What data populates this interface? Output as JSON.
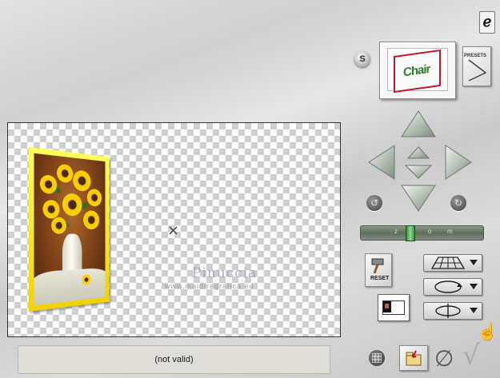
{
  "preview": {
    "thumb_text": "Chair",
    "presets_label": "PRESETS"
  },
  "s_badge": "S",
  "canvas": {
    "watermark_name": "Pinuccia",
    "watermark_url": "www.maidiregrafica.eu",
    "center_marker": "×"
  },
  "zoom": {
    "labels": [
      "z",
      "o",
      "m"
    ],
    "level": 0.38
  },
  "tools": {
    "reset_label": "RESET"
  },
  "status": {
    "text": "(not valid)"
  },
  "colors": {
    "frame": "#f5d400",
    "slider": "#6e7f6e",
    "arrow": "#b7c4b7"
  }
}
